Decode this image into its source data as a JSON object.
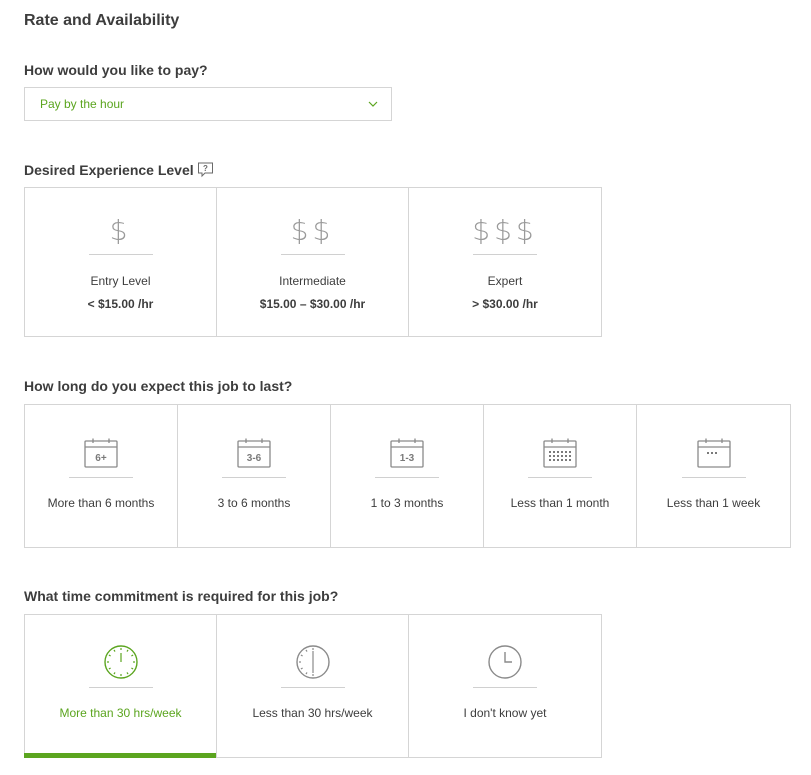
{
  "page_title": "Rate and Availability",
  "pay": {
    "question": "How would you like to pay?",
    "selected": "Pay by the hour"
  },
  "experience": {
    "question": "Desired Experience Level",
    "options": [
      {
        "symbol": "$",
        "label": "Entry Level",
        "rate": "< $15.00 /hr"
      },
      {
        "symbol": "$$",
        "label": "Intermediate",
        "rate": "$15.00 – $30.00 /hr"
      },
      {
        "symbol": "$$$",
        "label": "Expert",
        "rate": "> $30.00 /hr"
      }
    ]
  },
  "duration": {
    "question": "How long do you expect this job to last?",
    "options": [
      {
        "badge": "6+",
        "label": "More than 6 months"
      },
      {
        "badge": "3-6",
        "label": "3 to 6 months"
      },
      {
        "badge": "1-3",
        "label": "1 to 3 months"
      },
      {
        "badge": "",
        "label": "Less than 1 month"
      },
      {
        "badge": "",
        "label": "Less than 1 week"
      }
    ]
  },
  "commitment": {
    "question": "What time commitment is required for this job?",
    "options": [
      {
        "label": "More than 30 hrs/week",
        "selected": true
      },
      {
        "label": "Less than 30 hrs/week",
        "selected": false
      },
      {
        "label": "I don't know yet",
        "selected": false
      }
    ]
  },
  "colors": {
    "accent": "#5ba51f",
    "border": "#d5d5d5",
    "icon": "#8a8a8a"
  }
}
